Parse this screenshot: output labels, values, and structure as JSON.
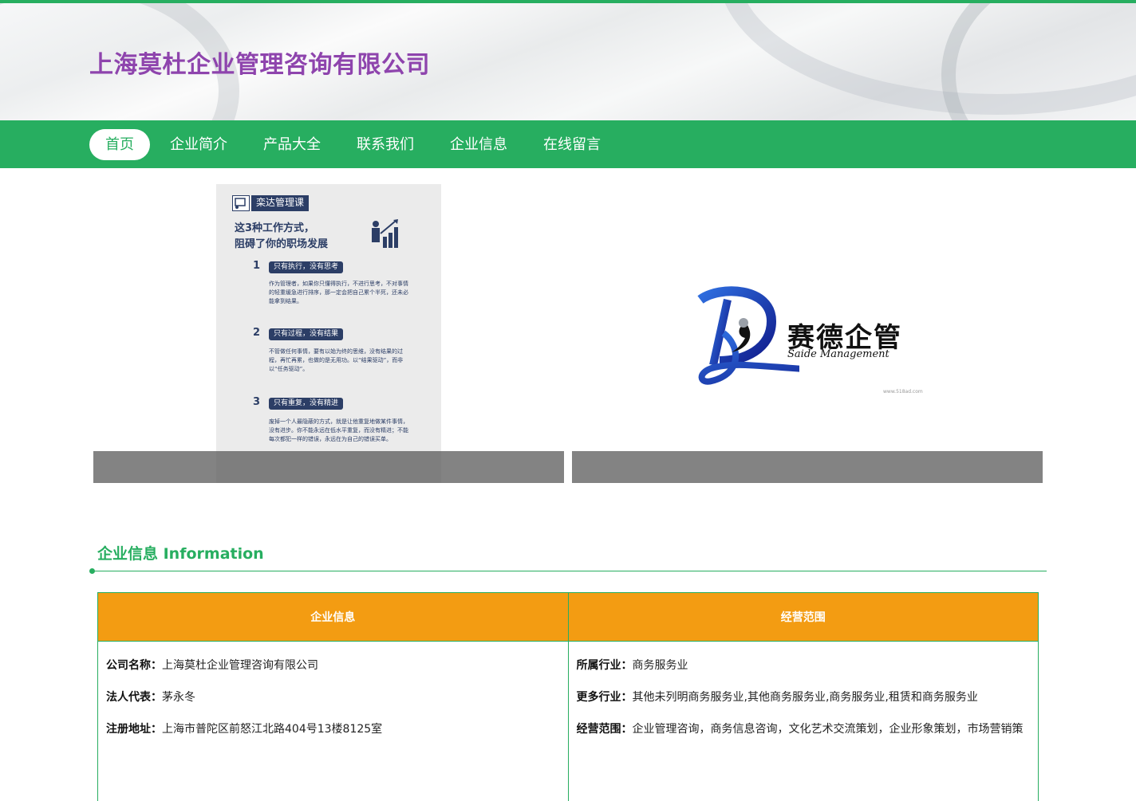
{
  "site": {
    "title": "上海莫杜企业管理咨询有限公司"
  },
  "nav": {
    "items": [
      {
        "label": "首页"
      },
      {
        "label": "企业简介"
      },
      {
        "label": "产品大全"
      },
      {
        "label": "联系我们"
      },
      {
        "label": "企业信息"
      },
      {
        "label": "在线留言"
      }
    ]
  },
  "slides": {
    "poster": {
      "tag": "栾达管理课",
      "headline_1": "这3种工作方式，",
      "headline_2": "阻碍了你的职场发展",
      "points": [
        {
          "num": "1",
          "pill": "只有执行，没有思考",
          "text": "作为管理者，如果你只懂得执行，不进行思考，不对事情的轻重缓急进行排序，那一定会把自己累个半死，还未必能拿到结果。"
        },
        {
          "num": "2",
          "pill": "只有过程，没有结果",
          "text": "不管做任何事情，要有以始为终的思维，没有结果的过程，再忙再累，也做的是无用功。以“结果驱动”，而非以“任务驱动”。"
        },
        {
          "num": "3",
          "pill": "只有重复，没有精进",
          "text": "废掉一个人最隐蔽的方式，就是让他重复地做某件事情，没有进步。你不能永远在低水平重复，而没有精进；不能每次都犯一样的错误，永远在为自己的错误买单。"
        }
      ]
    },
    "logo": {
      "name": "赛德企管",
      "subtitle": "Saide Management",
      "url": "www.518ad.com"
    }
  },
  "section": {
    "title": "企业信息 Information"
  },
  "table": {
    "headers": [
      "企业信息",
      "经营范围"
    ],
    "left": [
      {
        "key": "公司名称：",
        "value": "上海莫杜企业管理咨询有限公司"
      },
      {
        "key": "法人代表：",
        "value": "茅永冬"
      },
      {
        "key": "注册地址：",
        "value": "上海市普陀区前怒江北路404号13楼8125室"
      }
    ],
    "right": [
      {
        "key": "所属行业：",
        "value": "商务服务业"
      },
      {
        "key": "更多行业：",
        "value": "其他未列明商务服务业,其他商务服务业,商务服务业,租赁和商务服务业"
      },
      {
        "key": "经营范围：",
        "value": "企业管理咨询，商务信息咨询，文化艺术交流策划，企业形象策划，市场营销策"
      }
    ]
  },
  "colors": {
    "accent": "#27ae60",
    "title": "#8e44ad",
    "table_header": "#f39c12",
    "brand_blue": "#1b2f9a"
  }
}
